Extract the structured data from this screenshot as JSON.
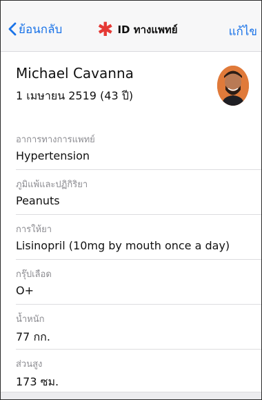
{
  "navbar": {
    "back_label": "ย้อนกลับ",
    "title": "ID ทางแพทย์",
    "edit_label": "แก้ไข"
  },
  "profile": {
    "name": "Michael Cavanna",
    "dob": "1 เมษายน 2519 (43 ปี)"
  },
  "fields": [
    {
      "label": "อาการทางการแพทย์",
      "value": "Hypertension"
    },
    {
      "label": "ภูมิแพ้และปฏิกิริยา",
      "value": "Peanuts"
    },
    {
      "label": "การให้ยา",
      "value": "Lisinopril (10mg by mouth once a day)"
    },
    {
      "label": "กรุ๊ปเลือด",
      "value": "O+"
    },
    {
      "label": "น้ำหนัก",
      "value": "77 กก."
    },
    {
      "label": "ส่วนสูง",
      "value": "173 ซม."
    }
  ],
  "colors": {
    "accent": "#1a73e8",
    "star": "#e53935"
  }
}
